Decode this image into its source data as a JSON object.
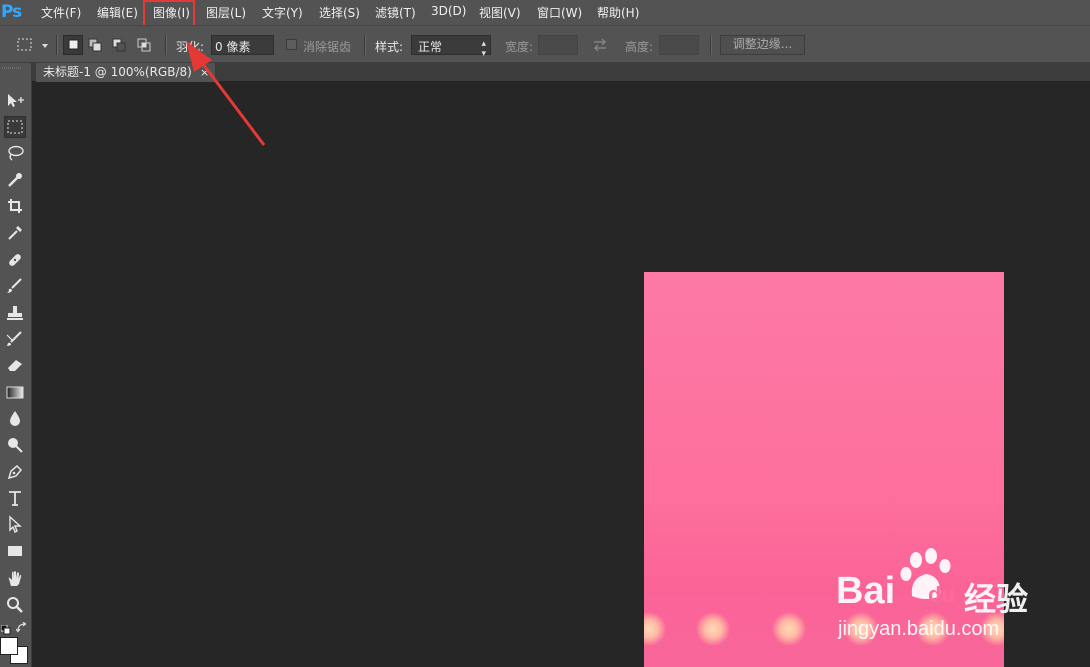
{
  "app": {
    "logo": "Ps"
  },
  "menu": [
    {
      "label": "文件(F)"
    },
    {
      "label": "编辑(E)"
    },
    {
      "label": "图像(I)"
    },
    {
      "label": "图层(L)"
    },
    {
      "label": "文字(Y)"
    },
    {
      "label": "选择(S)"
    },
    {
      "label": "滤镜(T)"
    },
    {
      "label": "3D(D)"
    },
    {
      "label": "视图(V)"
    },
    {
      "label": "窗口(W)"
    },
    {
      "label": "帮助(H)"
    }
  ],
  "options": {
    "feather_label": "羽化:",
    "feather_value": "0 像素",
    "antialias_label": "消除锯齿",
    "style_label": "样式:",
    "style_value": "正常",
    "width_label": "宽度:",
    "height_label": "高度:",
    "refine_edge_button": "调整边缘..."
  },
  "document": {
    "tab_title": "未标题-1 @ 100%(RGB/8)",
    "close_glyph": "×"
  },
  "tools": [
    {
      "name": "move-tool",
      "icon": "move-icon"
    },
    {
      "name": "rectangular-marquee-tool",
      "icon": "marquee-icon"
    },
    {
      "name": "lasso-tool",
      "icon": "lasso-icon"
    },
    {
      "name": "quick-selection-tool",
      "icon": "quick-selection-icon"
    },
    {
      "name": "crop-tool",
      "icon": "crop-icon"
    },
    {
      "name": "eyedropper-tool",
      "icon": "eyedropper-icon"
    },
    {
      "name": "healing-brush-tool",
      "icon": "bandage-icon"
    },
    {
      "name": "brush-tool",
      "icon": "brush-icon"
    },
    {
      "name": "clone-stamp-tool",
      "icon": "stamp-icon"
    },
    {
      "name": "history-brush-tool",
      "icon": "history-brush-icon"
    },
    {
      "name": "eraser-tool",
      "icon": "eraser-icon"
    },
    {
      "name": "gradient-tool",
      "icon": "gradient-icon"
    },
    {
      "name": "blur-tool",
      "icon": "droplet-icon"
    },
    {
      "name": "dodge-tool",
      "icon": "dodge-icon"
    },
    {
      "name": "pen-tool",
      "icon": "pen-icon"
    },
    {
      "name": "type-tool",
      "icon": "type-icon"
    },
    {
      "name": "path-selection-tool",
      "icon": "path-selection-icon"
    },
    {
      "name": "rectangle-shape-tool",
      "icon": "rectangle-icon"
    },
    {
      "name": "hand-tool",
      "icon": "hand-icon"
    },
    {
      "name": "zoom-tool",
      "icon": "zoom-icon"
    }
  ],
  "colors": {
    "menu_highlight": "#e53935",
    "annotation_arrow": "#e53935",
    "canvas_pink": "#fd79a6",
    "foreground": "#ffffff",
    "background": "#ffffff",
    "ps_blue": "#31a8ff"
  },
  "watermark": {
    "brand_bai": "Bai",
    "brand_du": "du",
    "brand_cn": "经验",
    "url": "jingyan.baidu.com"
  }
}
